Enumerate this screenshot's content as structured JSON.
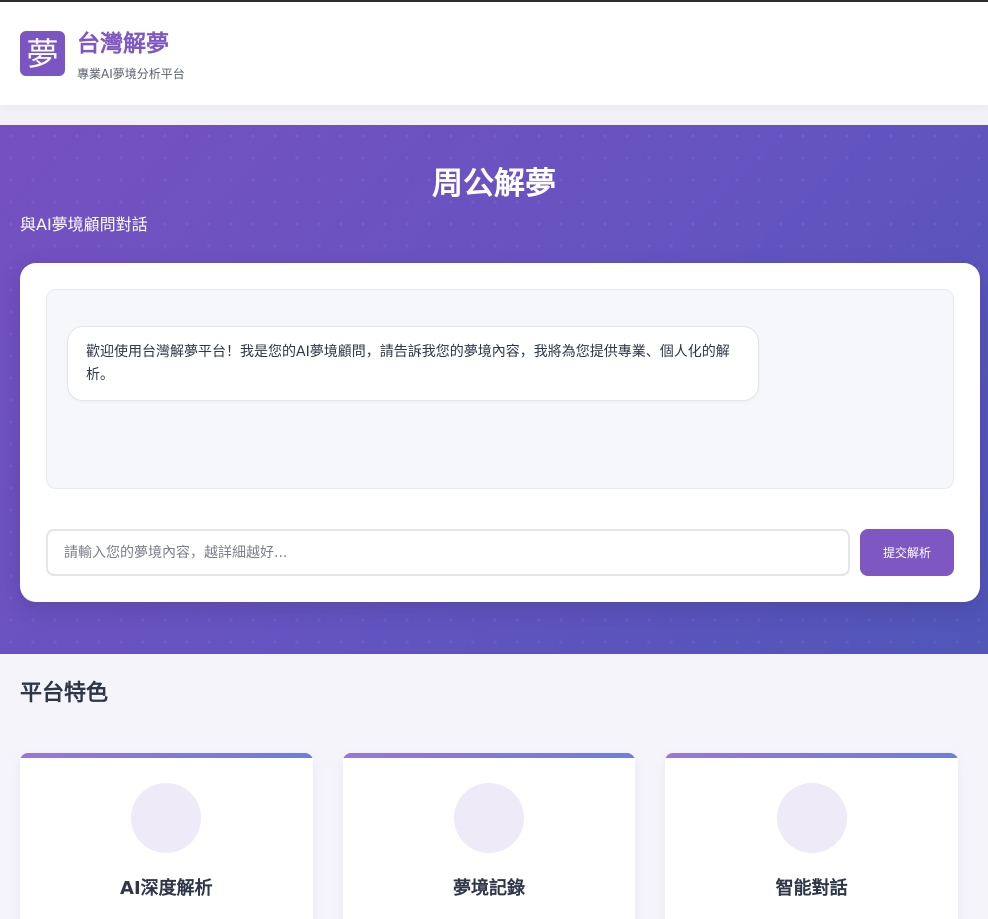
{
  "header": {
    "logo_glyph": "夢",
    "title": "台灣解夢",
    "subtitle": "專業AI夢境分析平台"
  },
  "hero": {
    "title": "周公解夢",
    "subtitle": "與AI夢境顧問對話"
  },
  "chat": {
    "welcome_message": "歡迎使用台灣解夢平台！我是您的AI夢境顧問，請告訴我您的夢境內容，我將為您提供專業、個人化的解析。",
    "input_value": "",
    "input_placeholder": "請輸入您的夢境內容，越詳細越好...",
    "submit_label": "提交解析"
  },
  "features": {
    "title": "平台特色",
    "cards": [
      {
        "title": "AI深度解析"
      },
      {
        "title": "夢境記錄"
      },
      {
        "title": "智能對話"
      }
    ]
  },
  "colors": {
    "brand": "#7e57c2",
    "hero_gradient_start": "#7550c0",
    "hero_gradient_end": "#5055b8",
    "text": "#2d3748"
  }
}
